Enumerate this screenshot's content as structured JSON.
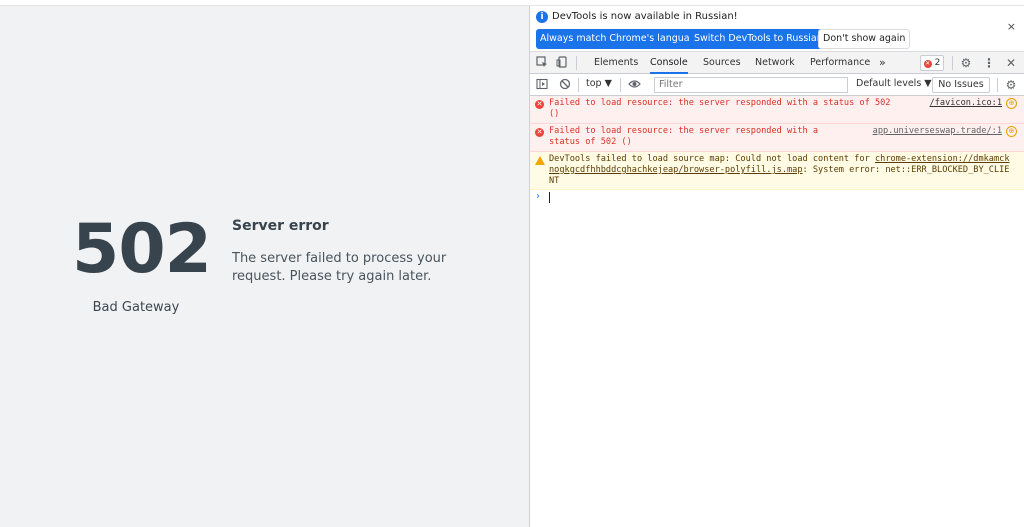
{
  "page": {
    "code": "502",
    "subtitle": "Bad Gateway",
    "title": "Server error",
    "message": "The server failed to process your request. Please try again later."
  },
  "devtools": {
    "infobar": {
      "text": "DevTools is now available in Russian!",
      "btn_match": "Always match Chrome's language",
      "btn_switch": "Switch DevTools to Russian",
      "btn_dismiss": "Don't show again",
      "close": "×"
    },
    "tabs": [
      "Elements",
      "Console",
      "Sources",
      "Network",
      "Performance"
    ],
    "more_tabs": "»",
    "error_count": "2",
    "toolbar": {
      "context": "top ▼",
      "filter_placeholder": "Filter",
      "levels": "Default levels ▼",
      "issues": "No Issues"
    },
    "messages": [
      {
        "level": "error",
        "text": "Failed to load resource: the server responded with a status of 502 ()",
        "source": "/favicon.ico:1"
      },
      {
        "level": "error",
        "text": "Failed to load resource: the server responded with a status of 502 ()",
        "source": "app.universeswap.trade/:1"
      },
      {
        "level": "warning",
        "text_prefix": "DevTools failed to load source map: Could not load content for ",
        "link": "chrome-extension://dmkamcknogkgcdfhhbddcghachkejeap/browser-polyfill.js.map",
        "text_suffix": ": System error: net::ERR_BLOCKED_BY_CLIENT"
      }
    ],
    "prompt": "›"
  },
  "colors": {
    "page_bg": "#f0f2f3",
    "code_color": "#37434d",
    "accent": "#1a73e8",
    "error_red": "#d93025",
    "warning_bg": "#fffbe5"
  }
}
